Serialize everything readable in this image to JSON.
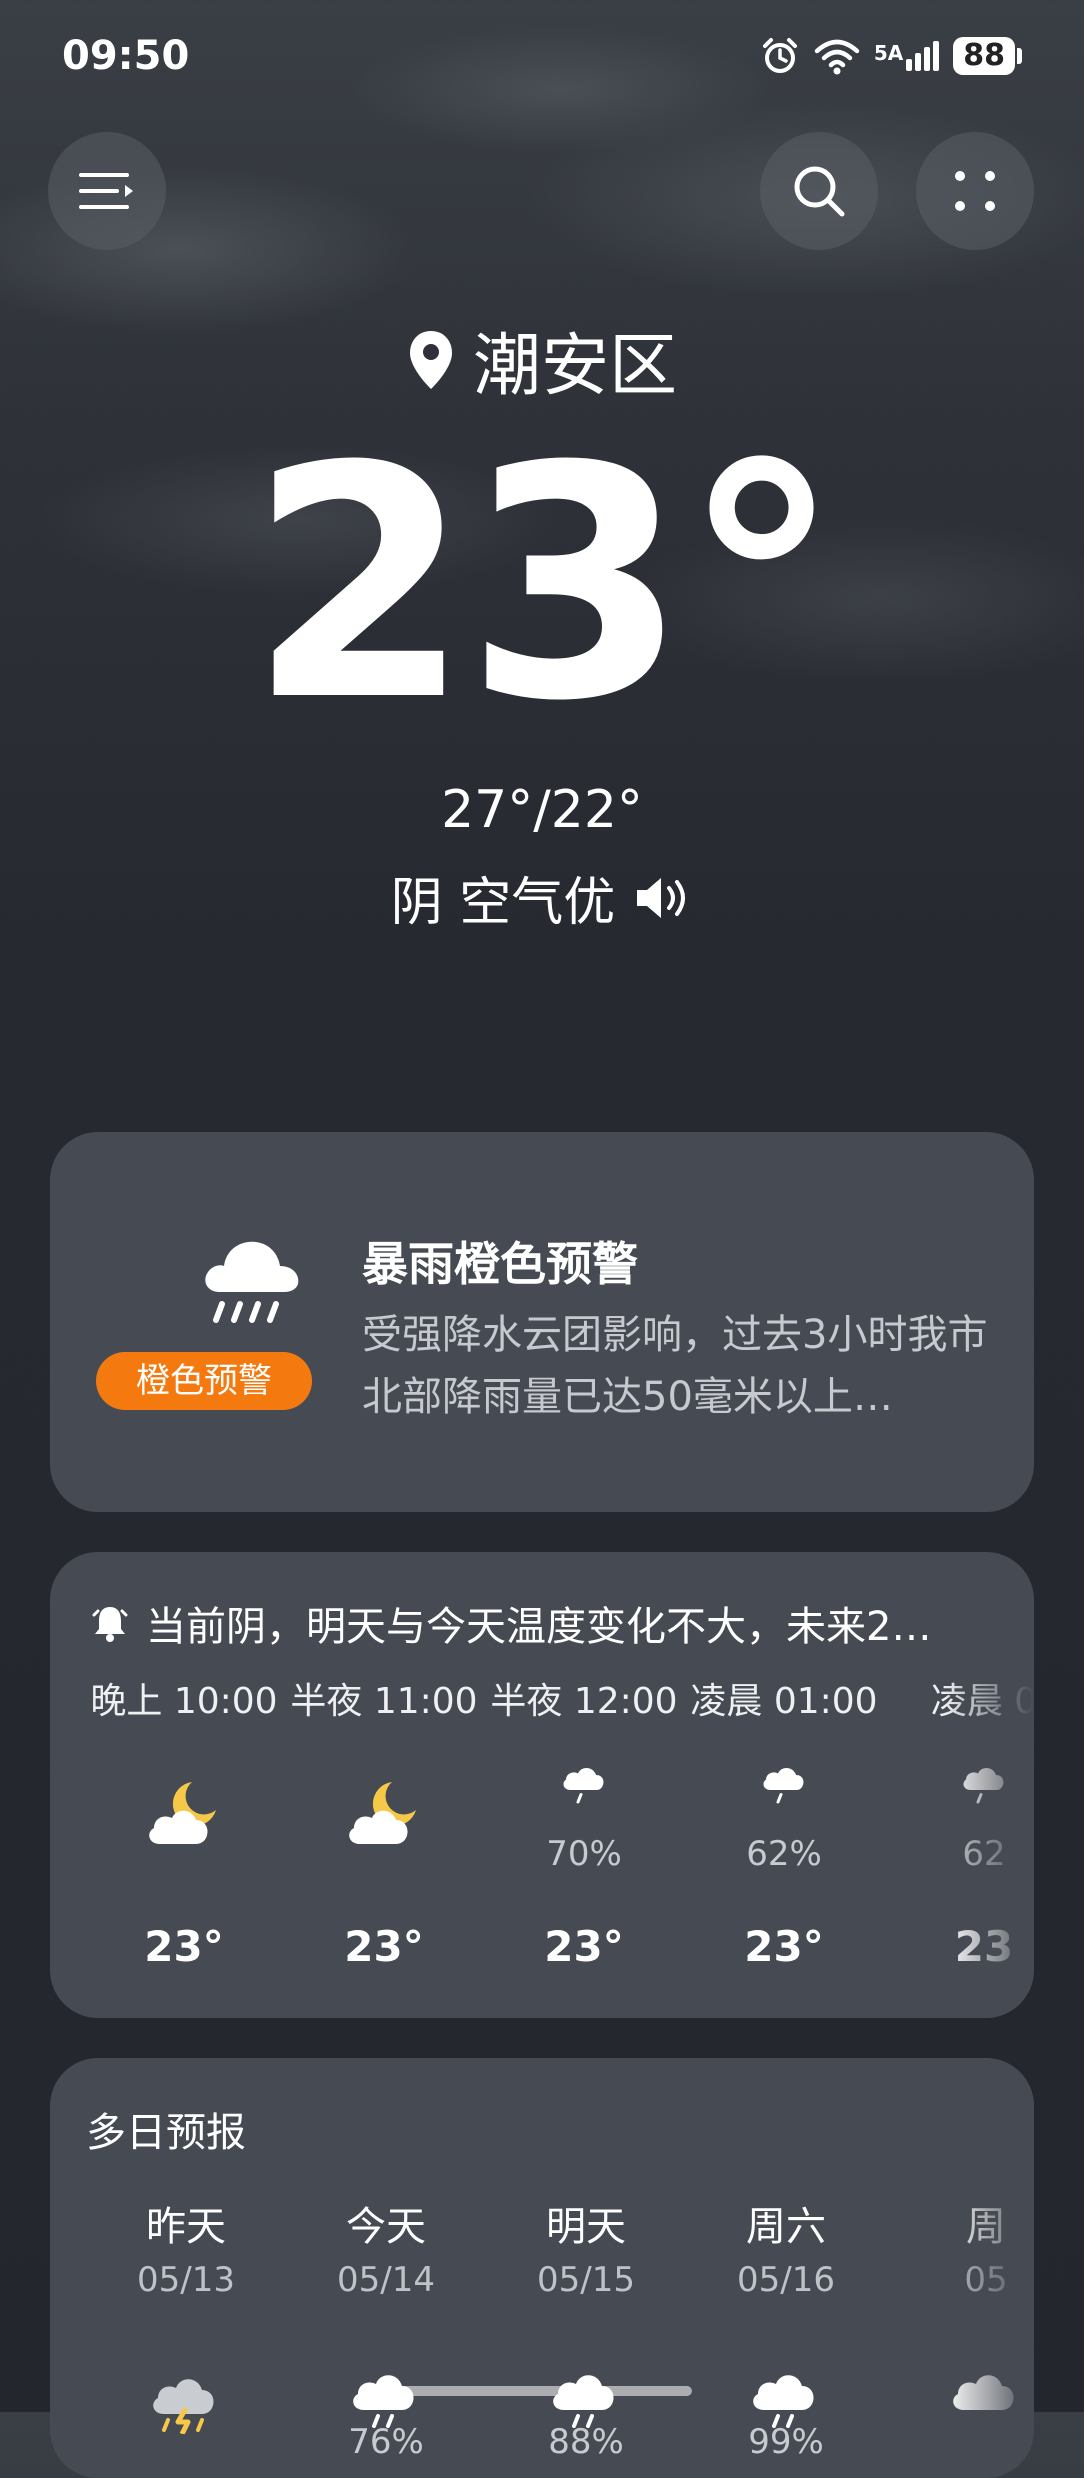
{
  "status_bar": {
    "time": "09:50",
    "network": "5A",
    "battery": "88"
  },
  "header": {
    "location": "潮安区"
  },
  "current": {
    "temperature": "23°",
    "hi_lo": "27°/22°",
    "condition": "阴 空气优"
  },
  "alert": {
    "badge": "橙色预警",
    "title": "暴雨橙色预警",
    "description": "受强降水云团影响，过去3小时我市北部降雨量已达50毫米以上…",
    "badge_color": "#f47a10"
  },
  "hourly": {
    "summary": "当前阴，明天与今天温度变化不大，未来2…",
    "items": [
      {
        "time": "晚上 10:00",
        "icon": "moon-cloud-icon",
        "precip": "",
        "temp": "23°"
      },
      {
        "time": "半夜 11:00",
        "icon": "moon-cloud-icon",
        "precip": "",
        "temp": "23°"
      },
      {
        "time": "半夜 12:00",
        "icon": "rain-cloud-icon",
        "precip": "70%",
        "temp": "23°"
      },
      {
        "time": "凌晨 01:00",
        "icon": "rain-cloud-icon",
        "precip": "62%",
        "temp": "23°"
      },
      {
        "time": "凌晨 0",
        "icon": "rain-cloud-icon",
        "precip": "62",
        "temp": "23"
      }
    ]
  },
  "daily": {
    "title": "多日预报",
    "items": [
      {
        "name": "昨天",
        "date": "05/13",
        "icon": "thunder-rain-icon",
        "precip": ""
      },
      {
        "name": "今天",
        "date": "05/14",
        "icon": "rain-cloud-icon",
        "precip": "76%"
      },
      {
        "name": "明天",
        "date": "05/15",
        "icon": "rain-cloud-icon",
        "precip": "88%"
      },
      {
        "name": "周六",
        "date": "05/16",
        "icon": "rain-cloud-icon",
        "precip": "99%"
      },
      {
        "name": "周",
        "date": "05",
        "icon": "rain-cloud-icon",
        "precip": ""
      }
    ]
  }
}
